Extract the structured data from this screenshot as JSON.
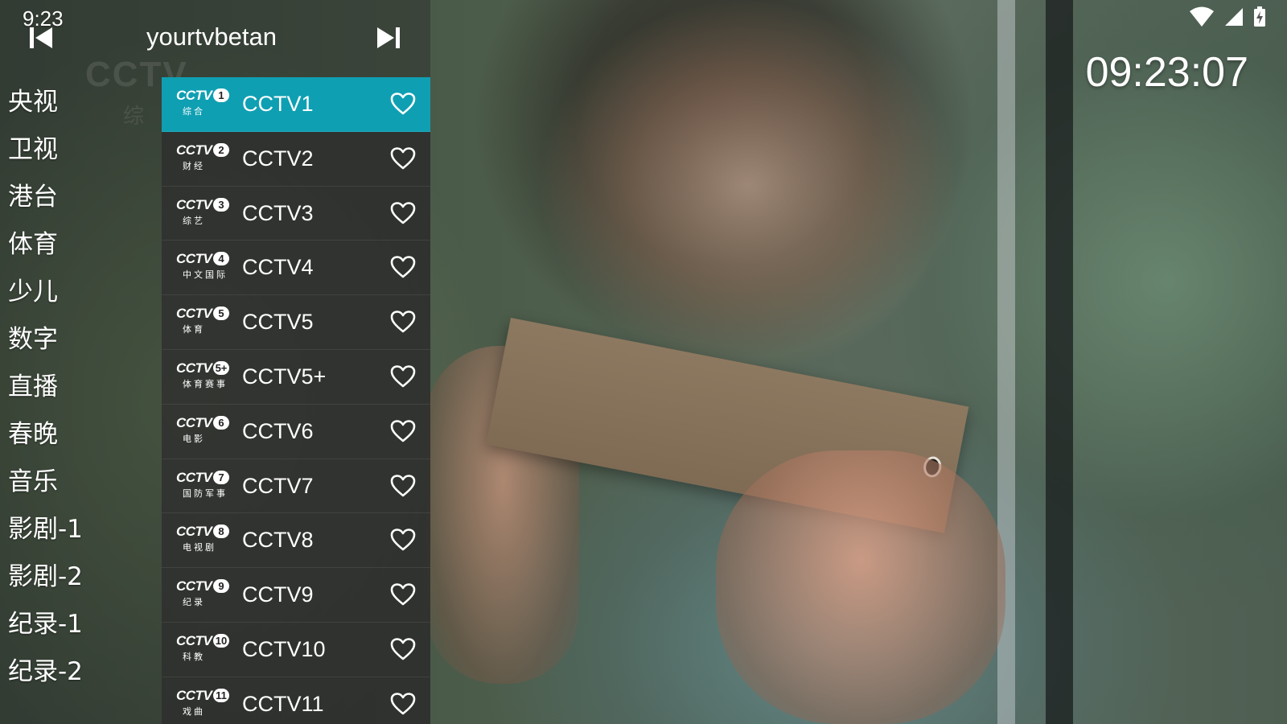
{
  "status_bar": {
    "time": "9:23",
    "icons": [
      "wifi-icon",
      "cellular-signal-icon",
      "battery-charging-icon"
    ]
  },
  "header": {
    "source_title": "yourtvbetan",
    "prev_icon": "skip-previous-icon",
    "next_icon": "skip-next-icon"
  },
  "video_overlay": {
    "watermark": "CCTV",
    "watermark_sub": "综"
  },
  "clock": "09:23:07",
  "categories": [
    {
      "label": "央视"
    },
    {
      "label": "卫视"
    },
    {
      "label": "港台"
    },
    {
      "label": "体育"
    },
    {
      "label": "少儿"
    },
    {
      "label": "数字"
    },
    {
      "label": "直播"
    },
    {
      "label": "春晚"
    },
    {
      "label": "音乐"
    },
    {
      "label": "影剧-1"
    },
    {
      "label": "影剧-2"
    },
    {
      "label": "纪录-1"
    },
    {
      "label": "纪录-2"
    }
  ],
  "channels": [
    {
      "name": "CCTV1",
      "logo_num": "1",
      "logo_sub": "综合",
      "active": true
    },
    {
      "name": "CCTV2",
      "logo_num": "2",
      "logo_sub": "财经",
      "active": false
    },
    {
      "name": "CCTV3",
      "logo_num": "3",
      "logo_sub": "综艺",
      "active": false
    },
    {
      "name": "CCTV4",
      "logo_num": "4",
      "logo_sub": "中文国际",
      "active": false
    },
    {
      "name": "CCTV5",
      "logo_num": "5",
      "logo_sub": "体育",
      "active": false
    },
    {
      "name": "CCTV5+",
      "logo_num": "5+",
      "logo_sub": "体育赛事",
      "active": false
    },
    {
      "name": "CCTV6",
      "logo_num": "6",
      "logo_sub": "电影",
      "active": false
    },
    {
      "name": "CCTV7",
      "logo_num": "7",
      "logo_sub": "国防军事",
      "active": false
    },
    {
      "name": "CCTV8",
      "logo_num": "8",
      "logo_sub": "电视剧",
      "active": false
    },
    {
      "name": "CCTV9",
      "logo_num": "9",
      "logo_sub": "纪录",
      "active": false
    },
    {
      "name": "CCTV10",
      "logo_num": "10",
      "logo_sub": "科教",
      "active": false
    },
    {
      "name": "CCTV11",
      "logo_num": "11",
      "logo_sub": "戏曲",
      "active": false
    }
  ],
  "logo_text": "CCTV",
  "colors": {
    "accent": "#0f9fb3",
    "row_bg": "#2d2d2d",
    "text": "#ffffff"
  }
}
